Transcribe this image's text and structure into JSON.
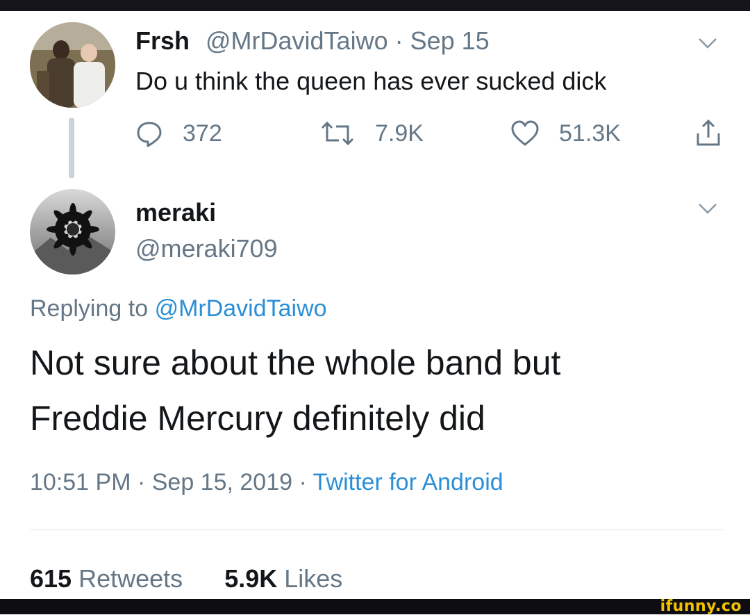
{
  "tweet_original": {
    "display_name": "Frsh",
    "handle_and_date": "@MrDavidTaiwo · Sep 15",
    "text": "Do u think the queen has ever sucked dick",
    "reply_count": "372",
    "retweet_count": "7.9K",
    "like_count": "51.3K",
    "icons": [
      "reply-icon",
      "retweet-icon",
      "like-icon",
      "share-icon",
      "chevron-down-icon"
    ]
  },
  "tweet_reply": {
    "display_name": "meraki",
    "handle": "@meraki709",
    "replying_prefix": "Replying to",
    "replying_handle": "@MrDavidTaiwo",
    "text_line1": "Not sure about the whole band but",
    "text_line2": "Freddie Mercury definitely did",
    "timestamp": "10:51 PM · Sep 15, 2019 ·",
    "source": "Twitter for Android",
    "retweets_count": "615",
    "retweets_label": "Retweets",
    "likes_count": "5.9K",
    "likes_label": "Likes"
  },
  "watermark": "ifunny.co",
  "colors": {
    "text_primary": "#14171a",
    "text_secondary": "#657786",
    "link": "#2b8fd6",
    "thread_line": "#c9d3dc",
    "watermark": "#f2c200"
  }
}
